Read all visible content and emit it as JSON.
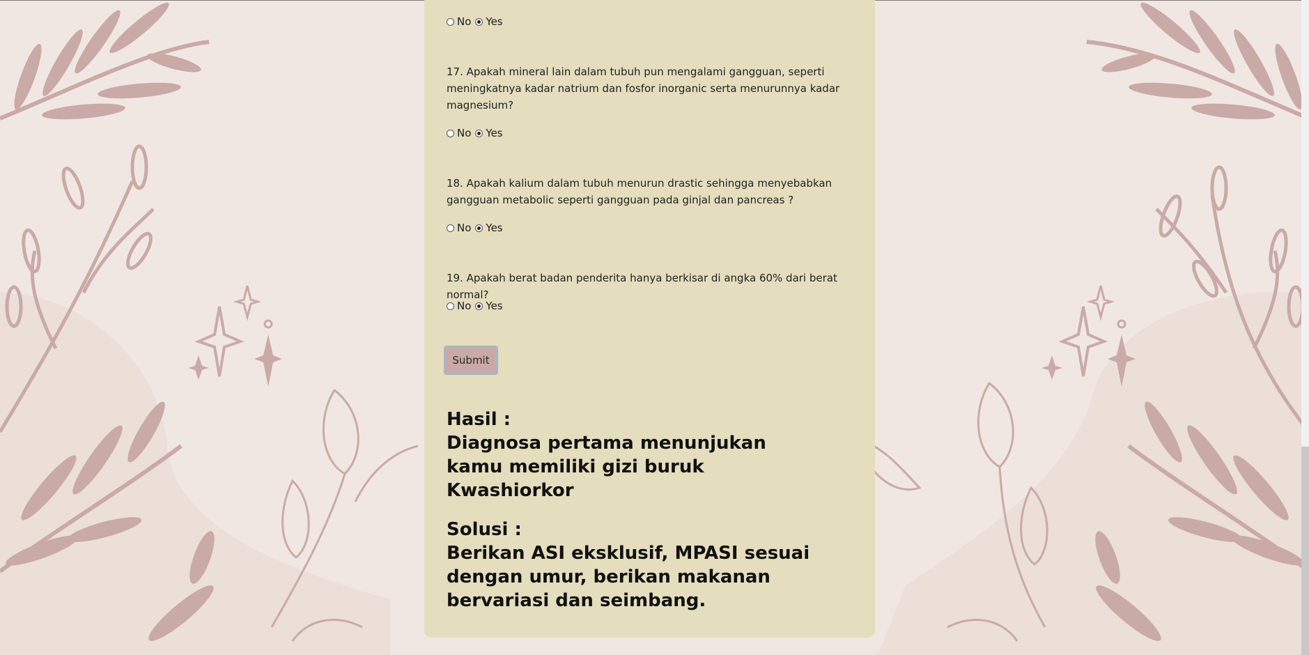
{
  "questions": [
    {
      "text": "",
      "options": {
        "no": "No",
        "yes": "Yes"
      },
      "selected": "yes"
    },
    {
      "text": "17. Apakah mineral lain dalam tubuh pun mengalami gangguan, seperti meningkatnya kadar natrium dan fosfor inorganic serta menurunnya kadar magnesium?",
      "options": {
        "no": "No",
        "yes": "Yes"
      },
      "selected": "yes"
    },
    {
      "text": "18. Apakah kalium dalam tubuh menurun drastic sehingga menyebabkan gangguan metabolic seperti gangguan pada ginjal dan pancreas ?",
      "options": {
        "no": "No",
        "yes": "Yes"
      },
      "selected": "yes"
    },
    {
      "text": "19. Apakah berat badan penderita hanya berkisar di angka 60% dari berat normal?",
      "options": {
        "no": "No",
        "yes": "Yes"
      },
      "selected": "yes"
    }
  ],
  "submit_label": "Submit",
  "result": {
    "heading": "Hasil :",
    "diagnosis": "Diagnosa pertama menunjukan kamu memiliki gizi buruk Kwashiorkor",
    "solution_heading": "Solusi :",
    "solution": "Berikan ASI eksklusif, MPASI sesuai dengan umur, berikan makanan bervariasi dan seimbang."
  },
  "colors": {
    "background": "#f1e7e2",
    "panel": "#e4ddbe",
    "leaf": "#c9aaa6",
    "button": "#c9aaa6"
  }
}
